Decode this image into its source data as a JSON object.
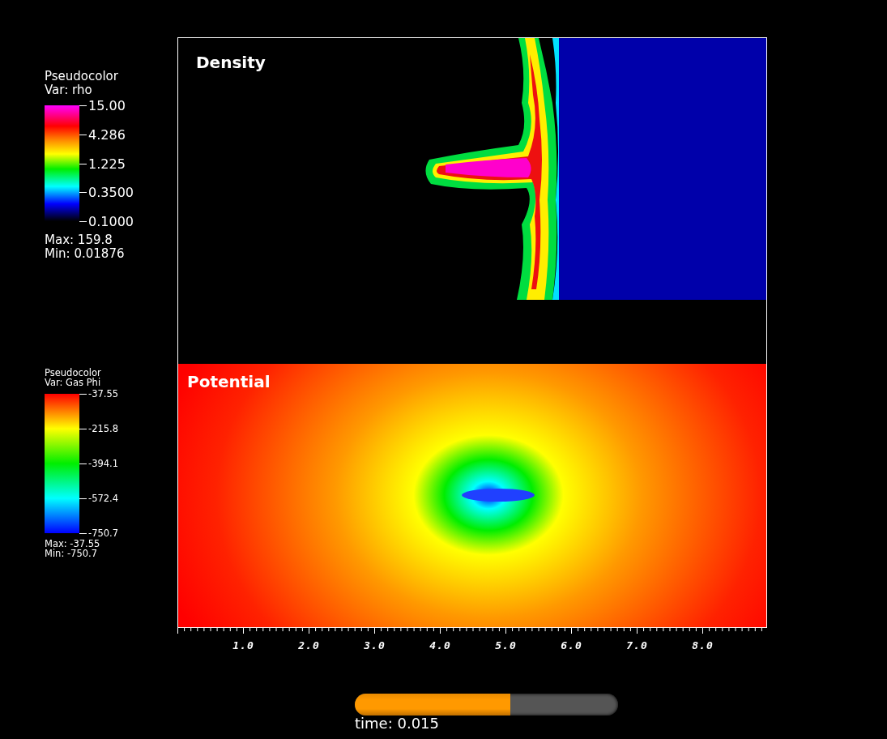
{
  "legends": [
    {
      "kind": "density",
      "title": "Pseudocolor",
      "variable": "Var: rho",
      "ticks": [
        "15.00",
        "4.286",
        "1.225",
        "0.3500",
        "0.1000"
      ],
      "max": "Max:  159.8",
      "min": "Min:  0.01876"
    },
    {
      "kind": "potential",
      "title": "Pseudocolor",
      "variable": "Var: Gas Phi",
      "ticks": [
        "-37.55",
        "-215.8",
        "-394.1",
        "-572.4",
        "-750.7"
      ],
      "max": "Max: -37.55",
      "min": "Min: -750.7"
    }
  ],
  "panels": [
    {
      "kind": "density",
      "title": "Density"
    },
    {
      "kind": "potential",
      "title": "Potential"
    }
  ],
  "x_axis": {
    "ticks": [
      "1.0",
      "2.0",
      "3.0",
      "4.0",
      "5.0",
      "6.0",
      "7.0",
      "8.0"
    ]
  },
  "time": {
    "label": "time: 0.015",
    "level": 0.59
  }
}
